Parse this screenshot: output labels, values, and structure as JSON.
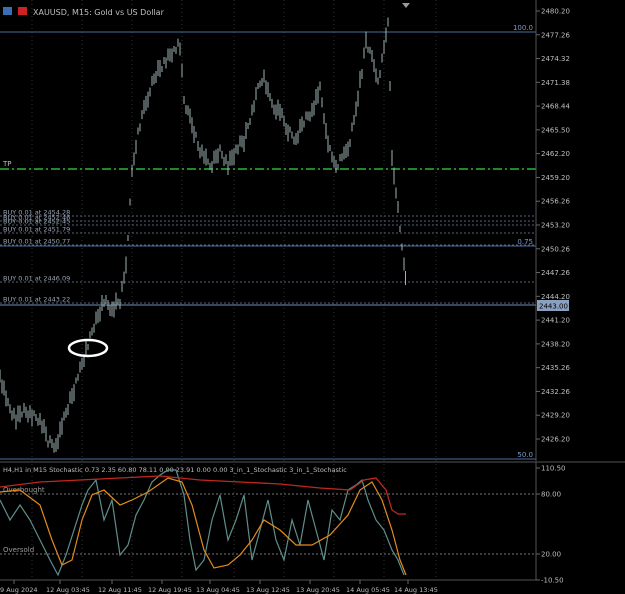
{
  "header": {
    "symbol_text": "XAUUSD, M15:  Gold vs US Dollar"
  },
  "price_axis": {
    "ticks": [
      "2480.20",
      "2477.26",
      "2474.32",
      "2471.38",
      "2468.44",
      "2465.50",
      "2462.20",
      "2459.20",
      "2456.26",
      "2453.20",
      "2450.26",
      "2447.26",
      "2444.20",
      "2441.20",
      "2438.20",
      "2435.26",
      "2432.26",
      "2429.20",
      "2426.20"
    ],
    "current_price": "2443.00"
  },
  "overlays": {
    "level_100": "100.0",
    "level_50": "50.0",
    "level_075": "0.75",
    "tp_label": "TP",
    "buy_orders": [
      "BUY 0.01 at 2454.28",
      "BUY 0.01 at 2452.46",
      "BUY 0.01 at 2452.45",
      "BUY 0.01 at 2451.79",
      "BUY 0.01 at 2450.77",
      "BUY 0.01 at 2446.09",
      "BUY 0.01 at 2443.22"
    ]
  },
  "indicator": {
    "title": "H4,H1 in M15 Stochastic 0.73 2.35 60.80 78.11 0.00 23.91 0.00 0.00 3_in_1_Stochastic 3_in_1_Stochastic",
    "axis_ticks": [
      "110.50",
      "80.00",
      "20.00",
      "-10.50"
    ],
    "overbought": "Overbought",
    "oversold": "Oversold"
  },
  "time_axis": {
    "labels": [
      "9 Aug 2024",
      "12 Aug 03:45",
      "12 Aug 11:45",
      "12 Aug 19:45",
      "13 Aug 04:45",
      "13 Aug 12:45",
      "13 Aug 20:45",
      "14 Aug 05:45",
      "14 Aug 13:45"
    ]
  },
  "colors": {
    "candle": "#9fb3b3",
    "grid": "#2a2a2a",
    "tp_line": "#27b53a",
    "order_line": "#5a6b80",
    "stoch_red": "#c0281e",
    "stoch_orange": "#e38b1d",
    "stoch_teal": "#5f8f8b"
  }
}
